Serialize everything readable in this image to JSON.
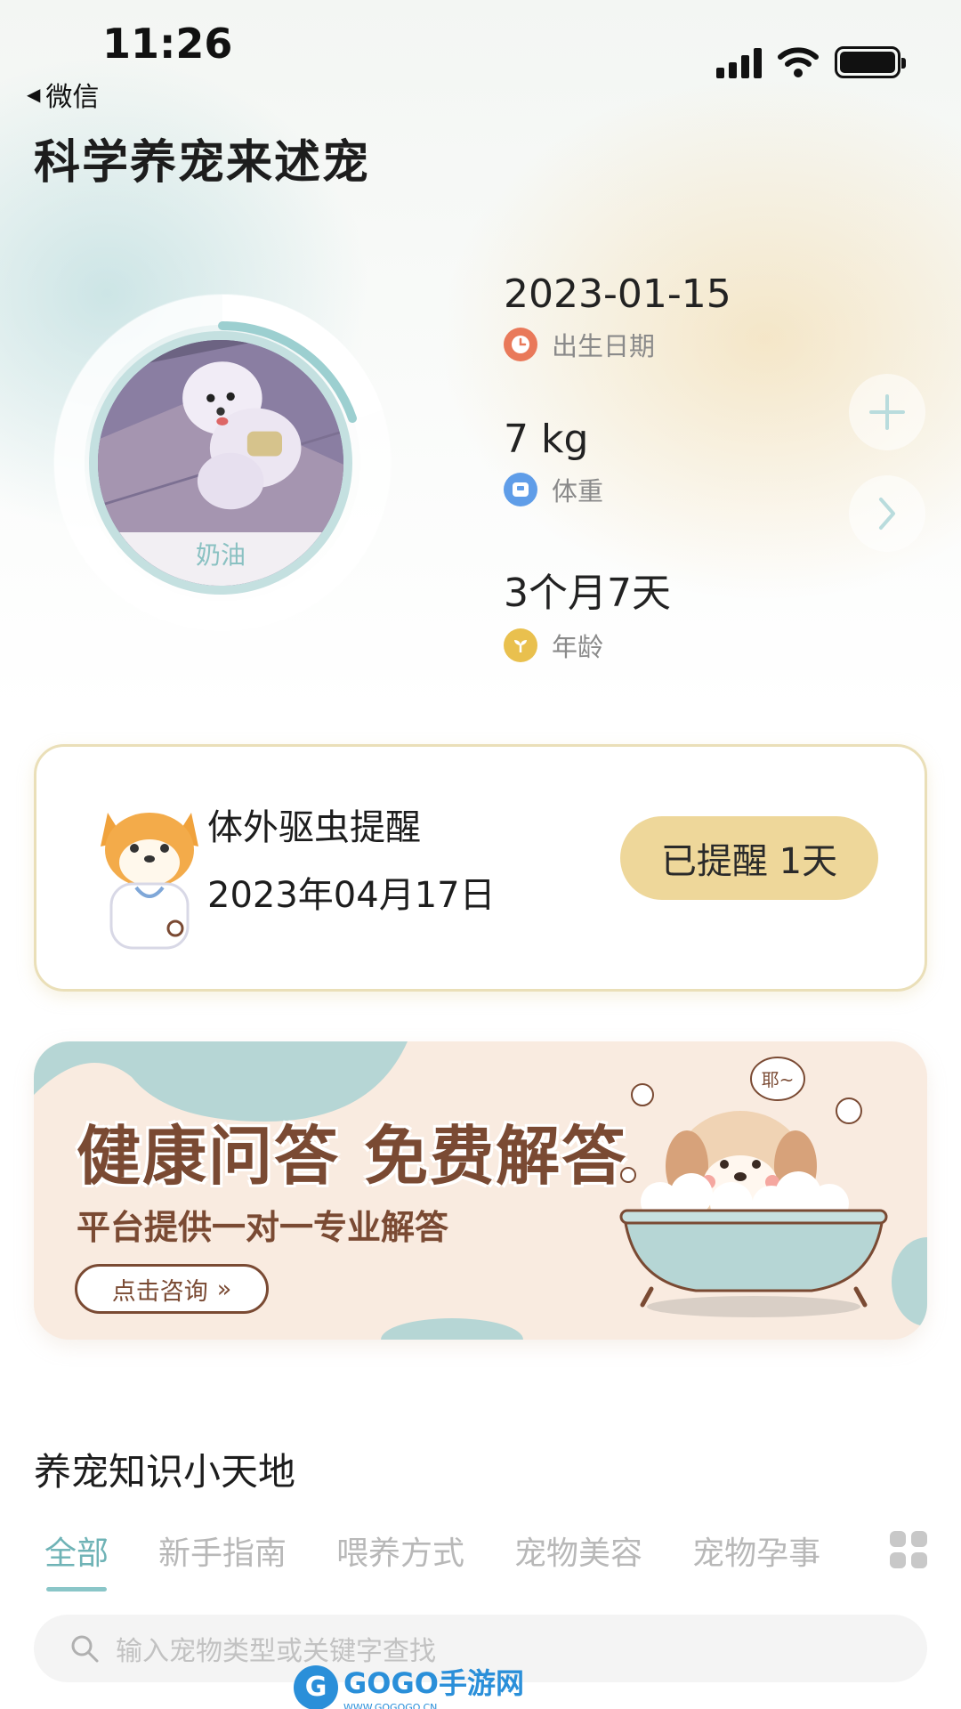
{
  "status_bar": {
    "time": "11:26",
    "back_label": "微信"
  },
  "header": {
    "title": "科学养宠来述宠"
  },
  "pet": {
    "name": "奶油",
    "birth_date": "2023-01-15",
    "birth_label": "出生日期",
    "weight": "7 kg",
    "weight_label": "体重",
    "age": "3个月7天",
    "age_label": "年龄"
  },
  "side_buttons": {
    "add_icon": "plus-icon",
    "next_icon": "chevron-right-icon"
  },
  "reminder": {
    "title": "体外驱虫提醒",
    "date": "2023年04月17日",
    "status": "已提醒 1天"
  },
  "banner": {
    "title": "健康问答 免费解答",
    "subtitle": "平台提供一对一专业解答",
    "button_label": "点击咨询",
    "bubble_text": "耶~"
  },
  "knowledge": {
    "title": "养宠知识小天地",
    "tabs": [
      "全部",
      "新手指南",
      "喂养方式",
      "宠物美容",
      "宠物孕事"
    ],
    "active_tab": 0,
    "search_placeholder": "输入宠物类型或关键字查找"
  },
  "watermark": {
    "logo": "G",
    "text": "GOGO手游网",
    "url": "WWW.GOGOGO.CN"
  },
  "colors": {
    "accent": "#6fb3b6",
    "pill": "#eed79a",
    "banner_text": "#7a4a33"
  }
}
